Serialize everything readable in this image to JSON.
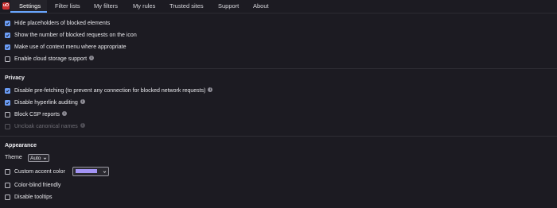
{
  "logo": {
    "text": "uO"
  },
  "tabs": [
    {
      "label": "Settings",
      "active": true
    },
    {
      "label": "Filter lists",
      "active": false
    },
    {
      "label": "My filters",
      "active": false
    },
    {
      "label": "My rules",
      "active": false
    },
    {
      "label": "Trusted sites",
      "active": false
    },
    {
      "label": "Support",
      "active": false
    },
    {
      "label": "About",
      "active": false
    }
  ],
  "general": {
    "items": [
      {
        "label": "Hide placeholders of blocked elements",
        "checked": true,
        "info": false
      },
      {
        "label": "Show the number of blocked requests on the icon",
        "checked": true,
        "info": false
      },
      {
        "label": "Make use of context menu where appropriate",
        "checked": true,
        "info": false
      },
      {
        "label": "Enable cloud storage support",
        "checked": false,
        "info": true
      }
    ]
  },
  "privacy": {
    "title": "Privacy",
    "items": [
      {
        "label": "Disable pre-fetching (to prevent any connection for blocked network requests)",
        "checked": true,
        "info": true
      },
      {
        "label": "Disable hyperlink auditing",
        "checked": true,
        "info": true
      },
      {
        "label": "Block CSP reports",
        "checked": false,
        "info": true
      },
      {
        "label": "Uncloak canonical names",
        "checked": false,
        "info": true,
        "disabled": true
      }
    ]
  },
  "appearance": {
    "title": "Appearance",
    "theme_label": "Theme",
    "theme_value": "Auto",
    "accent_label": "Custom accent color",
    "accent_checked": false,
    "accent_color": "#a394f5",
    "colorblind_label": "Color-blind friendly",
    "colorblind_checked": false,
    "tooltips_label": "Disable tooltips",
    "tooltips_checked": false
  },
  "icons": {
    "info": "info-icon",
    "check": "checkmark-icon",
    "chevron": "chevron-down-icon"
  },
  "colors": {
    "background": "#1c1b22",
    "accent": "#6c9ef8",
    "tab_underline": "#69a6ff",
    "logo": "#cc2f2f"
  }
}
